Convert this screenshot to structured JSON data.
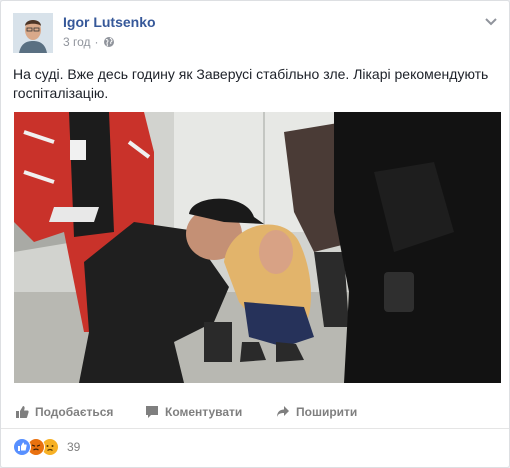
{
  "post": {
    "author": "Igor Lutsenko",
    "time": "3 год",
    "separator": "·",
    "privacy_icon": "globe-icon",
    "options_icon": "chevron-down-icon",
    "text": "На суді. Вже десь годину як Заверусі стабільно зле. Лікарі рекомендують госпіталізацію."
  },
  "actions": {
    "like": {
      "label": "Подобається",
      "icon": "thumbs-up-icon"
    },
    "comment": {
      "label": "Коментувати",
      "icon": "comment-icon"
    },
    "share": {
      "label": "Поширити",
      "icon": "share-icon"
    }
  },
  "reactions": {
    "icons": [
      "like-reaction-icon",
      "angry-reaction-icon",
      "sad-reaction-icon"
    ],
    "count": "39"
  },
  "colors": {
    "author": "#365899",
    "text": "#1d2129",
    "meta": "#90949c",
    "like": "#5890ff",
    "angry": "#e9710f",
    "sad": "#f7b125"
  }
}
